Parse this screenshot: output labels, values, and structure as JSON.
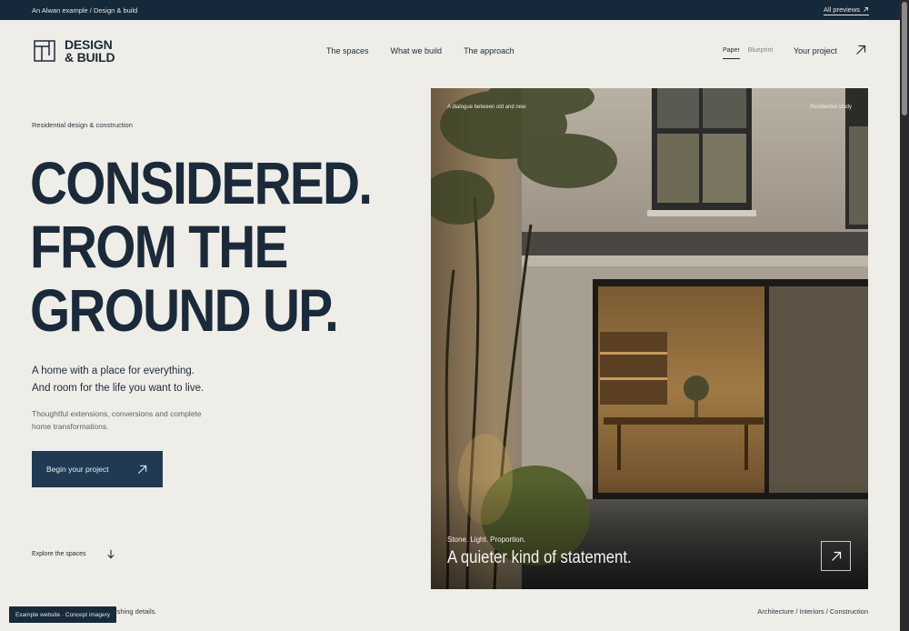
{
  "topbar": {
    "left_text": "An Alwan example / Design & build",
    "all_previews": "All previews"
  },
  "brand": {
    "line1": "DESIGN",
    "line2": "& BUILD"
  },
  "nav": {
    "items": [
      "The spaces",
      "What we build",
      "The approach"
    ]
  },
  "view_toggle": {
    "options": [
      "Paper",
      "Blueprint"
    ],
    "selected": "Paper"
  },
  "header": {
    "your_project": "Your project"
  },
  "hero": {
    "eyebrow": "Residential design & construction",
    "headline": [
      "CONSIDERED.",
      "FROM THE",
      "GROUND UP."
    ],
    "lead": [
      "A home with a place for everything.",
      "And room for the life you want to live."
    ],
    "sub": "Thoughtful extensions, conversions and complete home transformations.",
    "cta": "Begin your project",
    "explore": "Explore the spaces"
  },
  "image": {
    "label_left": "A dialogue between old and new",
    "label_right": "Residential study",
    "kicker": "Stone. Light. Proportion.",
    "title": "A quieter kind of statement."
  },
  "footer": {
    "left_partial": "ishing details.",
    "right": "Architecture / Interiors / Construction",
    "badge": "Example website · Concept imagery"
  },
  "colors": {
    "background": "#efede7",
    "navy": "#16293b",
    "button": "#1f3a52"
  }
}
